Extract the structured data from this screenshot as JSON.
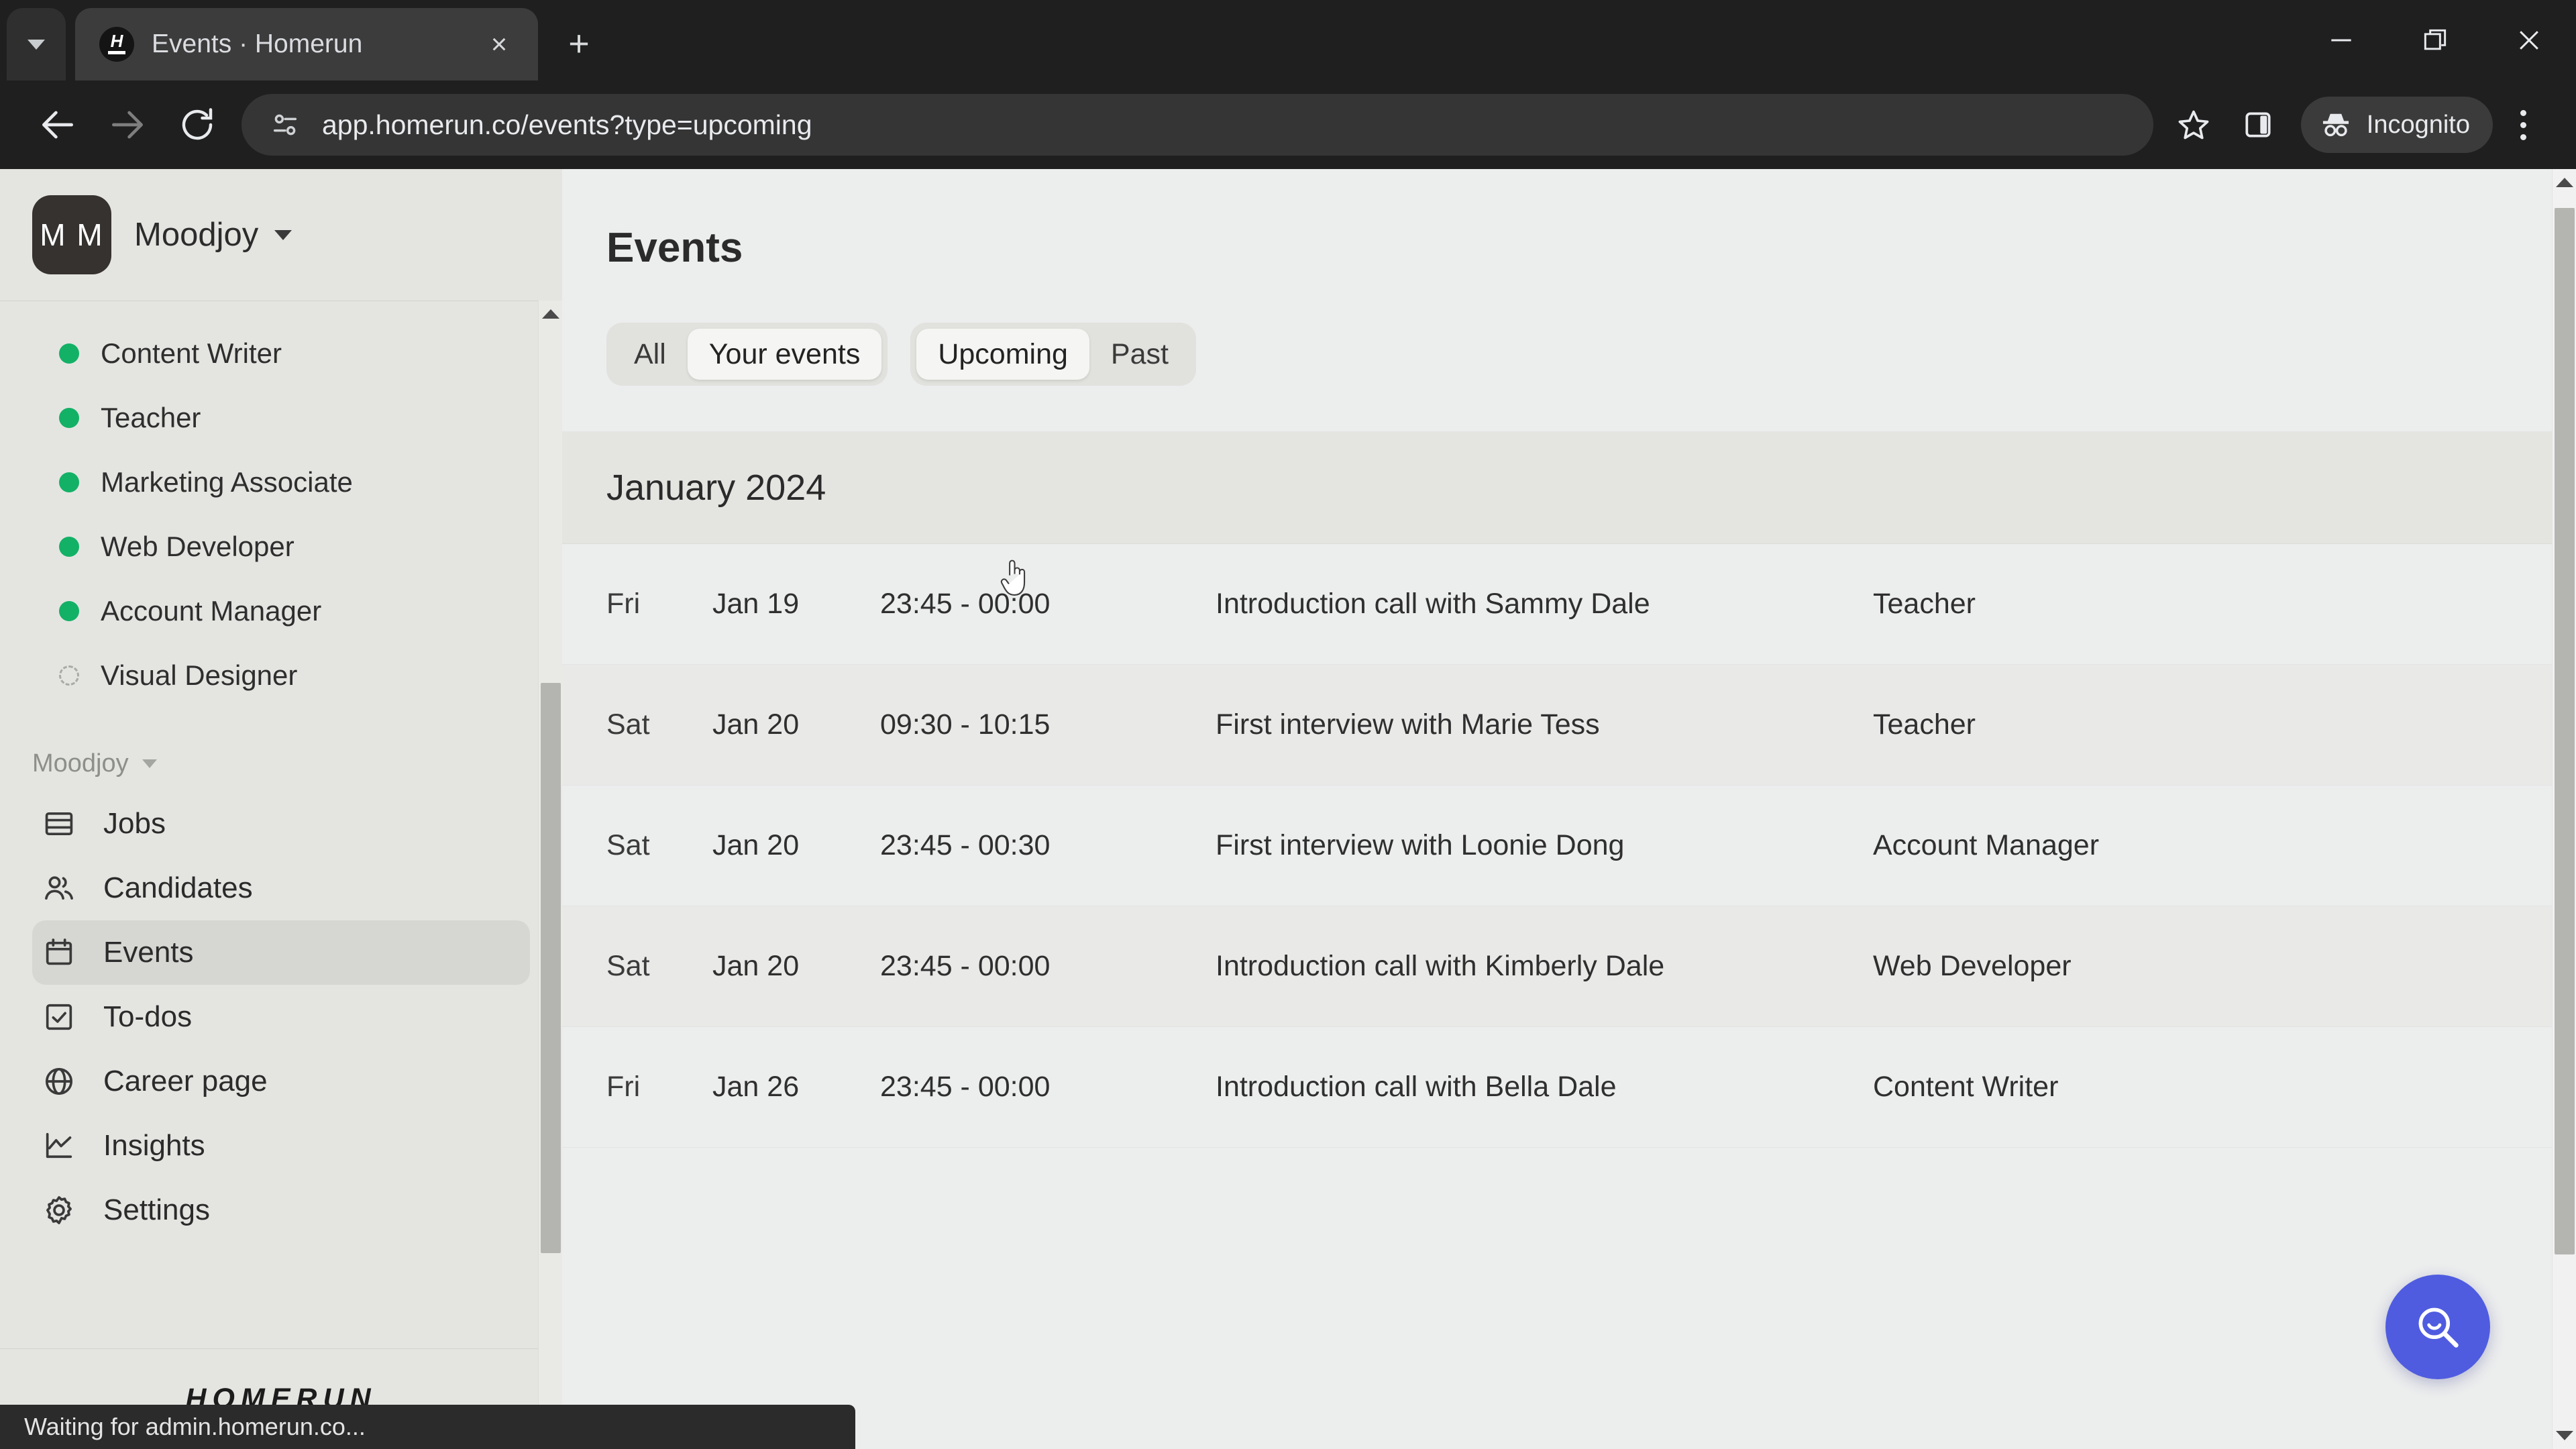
{
  "browser": {
    "tab": {
      "title": "Events · Homerun",
      "favicon_letter": "H"
    },
    "tab_list_label": "Search tabs",
    "new_tab_label": "+",
    "close_tab_label": "×",
    "window": {
      "minimize": "—",
      "maximize": "▣",
      "close": "✕"
    },
    "toolbar": {
      "back": "back-arrow",
      "forward": "forward-arrow",
      "reload": "reload-arrow",
      "url": "app.homerun.co/events?type=upcoming",
      "bookmark": "star-icon",
      "sidepanel": "side-panel-icon",
      "incognito_label": "Incognito",
      "menu": "kebab-menu"
    },
    "status_text": "Waiting for admin.homerun.co..."
  },
  "sidebar": {
    "workspace": {
      "initials": "M M",
      "name": "Moodjoy"
    },
    "jobs": [
      {
        "label": "Content Writer",
        "state": "published"
      },
      {
        "label": "Teacher",
        "state": "published"
      },
      {
        "label": "Marketing Associate",
        "state": "published"
      },
      {
        "label": "Web Developer",
        "state": "published"
      },
      {
        "label": "Account Manager",
        "state": "published"
      },
      {
        "label": "Visual Designer",
        "state": "draft"
      }
    ],
    "section_label": "Moodjoy",
    "nav": [
      {
        "label": "Jobs",
        "icon": "jobs-icon",
        "active": false
      },
      {
        "label": "Candidates",
        "icon": "candidates-icon",
        "active": false
      },
      {
        "label": "Events",
        "icon": "calendar-icon",
        "active": true
      },
      {
        "label": "To-dos",
        "icon": "checkbox-icon",
        "active": false
      },
      {
        "label": "Career page",
        "icon": "globe-icon",
        "active": false
      },
      {
        "label": "Insights",
        "icon": "chart-icon",
        "active": false
      },
      {
        "label": "Settings",
        "icon": "gear-icon",
        "active": false
      }
    ],
    "footer_logo": "HOMERUN"
  },
  "main": {
    "page_title": "Events",
    "filters": {
      "scope": {
        "options": [
          "All",
          "Your events"
        ],
        "selected": "Your events"
      },
      "time": {
        "options": [
          "Upcoming",
          "Past"
        ],
        "selected": "Upcoming"
      }
    },
    "month_header": "January 2024",
    "events": [
      {
        "dow": "Fri",
        "date": "Jan 19",
        "time": "23:45 - 00:00",
        "title": "Introduction call with Sammy Dale",
        "job": "Teacher"
      },
      {
        "dow": "Sat",
        "date": "Jan 20",
        "time": "09:30 - 10:15",
        "title": "First interview with Marie Tess",
        "job": "Teacher"
      },
      {
        "dow": "Sat",
        "date": "Jan 20",
        "time": "23:45 - 00:30",
        "title": "First interview with Loonie Dong",
        "job": "Account Manager"
      },
      {
        "dow": "Sat",
        "date": "Jan 20",
        "time": "23:45 - 00:00",
        "title": "Introduction call with Kimberly Dale",
        "job": "Web Developer"
      },
      {
        "dow": "Fri",
        "date": "Jan 26",
        "time": "23:45 - 00:00",
        "title": "Introduction call with Bella Dale",
        "job": "Content Writer"
      }
    ],
    "search_fab": "search-icon"
  },
  "colors": {
    "chrome_bg": "#1f1f1f",
    "sidebar_bg": "#e4e5e1",
    "content_bg": "#eceded",
    "accent_fab": "#4f5ce0",
    "status_dot_green": "#13b166",
    "nav_active_bg": "#d6d7d2"
  }
}
